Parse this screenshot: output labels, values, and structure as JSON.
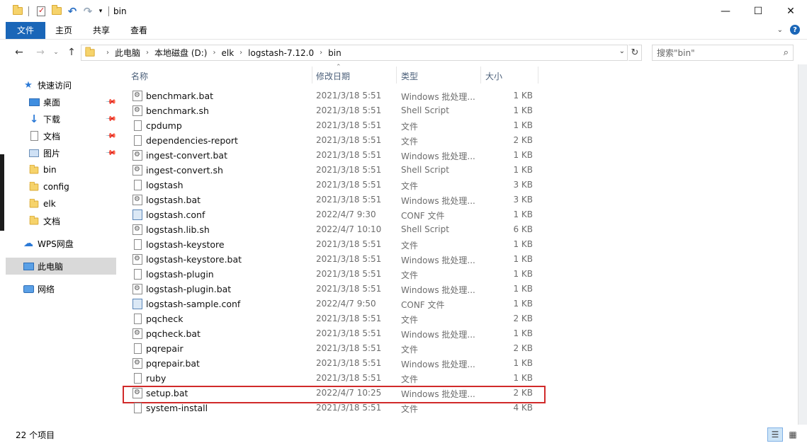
{
  "window": {
    "title": "bin",
    "minimize": "—",
    "maximize": "☐",
    "close": "✕"
  },
  "ribbon": {
    "tabs": [
      "文件",
      "主页",
      "共享",
      "查看"
    ]
  },
  "address": {
    "crumbs": [
      "此电脑",
      "本地磁盘 (D:)",
      "elk",
      "logstash-7.12.0",
      "bin"
    ],
    "search_placeholder": "搜索\"bin\""
  },
  "sidebar": {
    "items": [
      {
        "label": "快速访问",
        "icon": "star-icon"
      },
      {
        "label": "桌面",
        "icon": "desktop-icon",
        "pinned": true
      },
      {
        "label": "下载",
        "icon": "download-icon",
        "pinned": true
      },
      {
        "label": "文档",
        "icon": "document-icon",
        "pinned": true
      },
      {
        "label": "图片",
        "icon": "pictures-icon",
        "pinned": true
      },
      {
        "label": "bin",
        "icon": "folder-icon"
      },
      {
        "label": "config",
        "icon": "folder-icon"
      },
      {
        "label": "elk",
        "icon": "folder-icon"
      },
      {
        "label": "文档",
        "icon": "folder-icon"
      },
      {
        "label": "WPS网盘",
        "icon": "cloud-icon"
      },
      {
        "label": "此电脑",
        "icon": "computer-icon",
        "selected": true
      },
      {
        "label": "网络",
        "icon": "network-icon"
      }
    ]
  },
  "columns": {
    "name": "名称",
    "date": "修改日期",
    "type": "类型",
    "size": "大小"
  },
  "files": [
    {
      "name": "benchmark.bat",
      "date": "2021/3/18 5:51",
      "type": "Windows 批处理...",
      "size": "1 KB",
      "icon": "bat"
    },
    {
      "name": "benchmark.sh",
      "date": "2021/3/18 5:51",
      "type": "Shell Script",
      "size": "1 KB",
      "icon": "bat"
    },
    {
      "name": "cpdump",
      "date": "2021/3/18 5:51",
      "type": "文件",
      "size": "1 KB",
      "icon": "plain"
    },
    {
      "name": "dependencies-report",
      "date": "2021/3/18 5:51",
      "type": "文件",
      "size": "2 KB",
      "icon": "plain"
    },
    {
      "name": "ingest-convert.bat",
      "date": "2021/3/18 5:51",
      "type": "Windows 批处理...",
      "size": "1 KB",
      "icon": "bat"
    },
    {
      "name": "ingest-convert.sh",
      "date": "2021/3/18 5:51",
      "type": "Shell Script",
      "size": "1 KB",
      "icon": "bat"
    },
    {
      "name": "logstash",
      "date": "2021/3/18 5:51",
      "type": "文件",
      "size": "3 KB",
      "icon": "plain"
    },
    {
      "name": "logstash.bat",
      "date": "2021/3/18 5:51",
      "type": "Windows 批处理...",
      "size": "3 KB",
      "icon": "bat"
    },
    {
      "name": "logstash.conf",
      "date": "2022/4/7 9:30",
      "type": "CONF 文件",
      "size": "1 KB",
      "icon": "conf"
    },
    {
      "name": "logstash.lib.sh",
      "date": "2022/4/7 10:10",
      "type": "Shell Script",
      "size": "6 KB",
      "icon": "bat"
    },
    {
      "name": "logstash-keystore",
      "date": "2021/3/18 5:51",
      "type": "文件",
      "size": "1 KB",
      "icon": "plain"
    },
    {
      "name": "logstash-keystore.bat",
      "date": "2021/3/18 5:51",
      "type": "Windows 批处理...",
      "size": "1 KB",
      "icon": "bat"
    },
    {
      "name": "logstash-plugin",
      "date": "2021/3/18 5:51",
      "type": "文件",
      "size": "1 KB",
      "icon": "plain"
    },
    {
      "name": "logstash-plugin.bat",
      "date": "2021/3/18 5:51",
      "type": "Windows 批处理...",
      "size": "1 KB",
      "icon": "bat"
    },
    {
      "name": "logstash-sample.conf",
      "date": "2022/4/7 9:50",
      "type": "CONF 文件",
      "size": "1 KB",
      "icon": "conf"
    },
    {
      "name": "pqcheck",
      "date": "2021/3/18 5:51",
      "type": "文件",
      "size": "2 KB",
      "icon": "plain"
    },
    {
      "name": "pqcheck.bat",
      "date": "2021/3/18 5:51",
      "type": "Windows 批处理...",
      "size": "1 KB",
      "icon": "bat"
    },
    {
      "name": "pqrepair",
      "date": "2021/3/18 5:51",
      "type": "文件",
      "size": "2 KB",
      "icon": "plain"
    },
    {
      "name": "pqrepair.bat",
      "date": "2021/3/18 5:51",
      "type": "Windows 批处理...",
      "size": "1 KB",
      "icon": "bat"
    },
    {
      "name": "ruby",
      "date": "2021/3/18 5:51",
      "type": "文件",
      "size": "1 KB",
      "icon": "plain"
    },
    {
      "name": "setup.bat",
      "date": "2022/4/7 10:25",
      "type": "Windows 批处理...",
      "size": "2 KB",
      "icon": "bat",
      "highlighted": true
    },
    {
      "name": "system-install",
      "date": "2021/3/18 5:51",
      "type": "文件",
      "size": "4 KB",
      "icon": "plain"
    }
  ],
  "status": {
    "item_count": "22 个项目"
  },
  "colors": {
    "accent": "#1a66b8",
    "highlight_border": "#d12a2a"
  }
}
